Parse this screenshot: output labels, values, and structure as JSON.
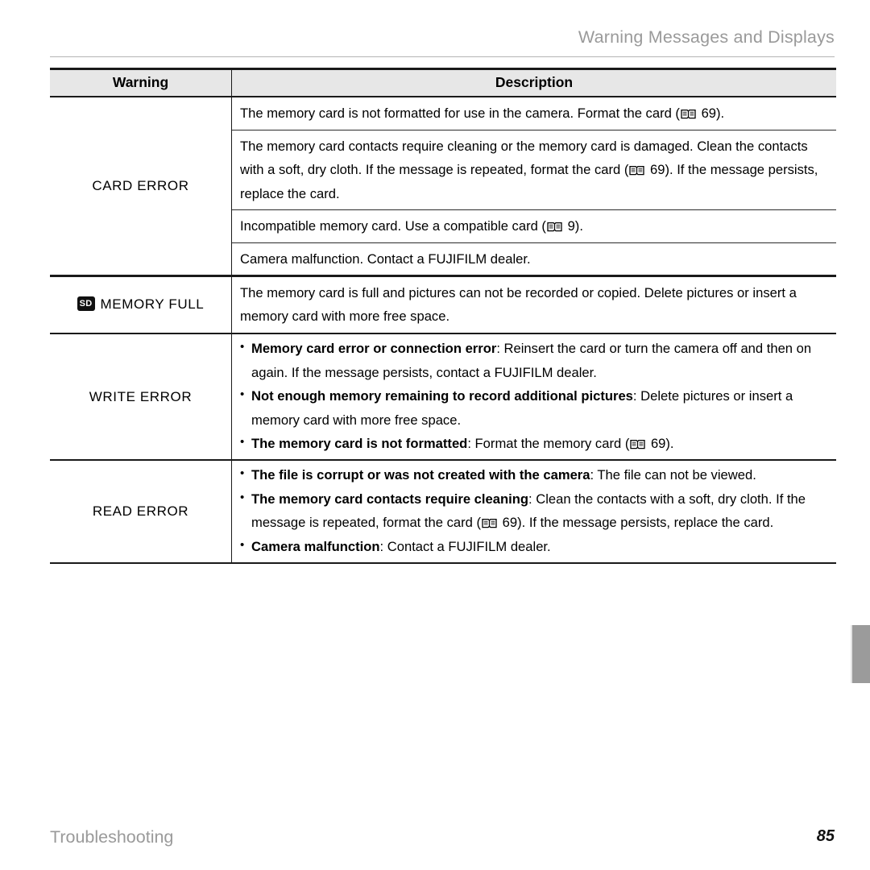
{
  "running_head": "Warning Messages and Displays",
  "table": {
    "columns": {
      "warning": "Warning",
      "description": "Description"
    },
    "groups": [
      {
        "label": "CARD ERROR",
        "icon": null,
        "type": "plain",
        "rows": [
          {
            "segments": [
              {
                "text": "The memory card is not formatted for use in the camera.  Format the card ("
              },
              {
                "icon": "book-icon"
              },
              {
                "text": " 69)."
              }
            ]
          },
          {
            "segments": [
              {
                "text": "The memory card contacts require cleaning or the memory card is damaged.  Clean the contacts with a soft, dry cloth.  If the message is repeated, format the card ("
              },
              {
                "icon": "book-icon"
              },
              {
                "text": " 69).  If the message persists, replace the card."
              }
            ]
          },
          {
            "segments": [
              {
                "text": "Incompatible memory card.  Use a compatible card ("
              },
              {
                "icon": "book-icon"
              },
              {
                "text": " 9)."
              }
            ]
          },
          {
            "segments": [
              {
                "text": "Camera malfunction.  Contact a FUJIFILM dealer."
              }
            ]
          }
        ]
      },
      {
        "label": "MEMORY FULL",
        "icon": "sd-card-icon",
        "icon_text": "SD",
        "type": "plain",
        "rows": [
          {
            "segments": [
              {
                "text": "The memory card is full and pictures can not be recorded or copied.  Delete pictures or insert a memory card with more free space."
              }
            ]
          }
        ]
      },
      {
        "label": "WRITE ERROR",
        "icon": null,
        "type": "bullets",
        "bullets": [
          {
            "lead": "Memory card error or connection error",
            "segments": [
              {
                "text": ": Reinsert the card or turn the camera off and then on again.  If the message persists, contact a FUJIFILM dealer."
              }
            ]
          },
          {
            "lead": "Not enough memory remaining to record additional pictures",
            "segments": [
              {
                "text": ": Delete pictures or insert a memory card with more free space."
              }
            ]
          },
          {
            "lead": "The memory card is not formatted",
            "segments": [
              {
                "text": ": Format the memory card ("
              },
              {
                "icon": "book-icon"
              },
              {
                "text": " 69)."
              }
            ]
          }
        ]
      },
      {
        "label": "READ ERROR",
        "icon": null,
        "type": "bullets",
        "bullets": [
          {
            "lead": "The file is corrupt or was not created with the camera",
            "segments": [
              {
                "text": ": The file can not be viewed."
              }
            ]
          },
          {
            "lead": "The memory card contacts require cleaning",
            "segments": [
              {
                "text": ": Clean the contacts with a soft, dry cloth.  If the message is repeated, format the card ("
              },
              {
                "icon": "book-icon"
              },
              {
                "text": " 69).  If the message persists, replace the card."
              }
            ]
          },
          {
            "lead": "Camera malfunction",
            "segments": [
              {
                "text": ": Contact a FUJIFILM dealer."
              }
            ]
          }
        ]
      }
    ]
  },
  "footer": {
    "section": "Troubleshooting",
    "page_number": "85"
  },
  "colors": {
    "rule": "#1a1a1a",
    "header_bg": "#e7e7e7",
    "muted_text": "#9a9a9a",
    "edge_tab": "#9b9b9b"
  }
}
